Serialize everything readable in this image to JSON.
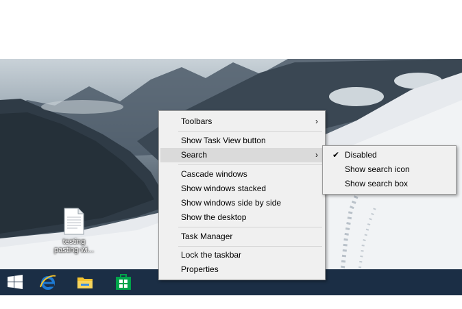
{
  "desktop": {
    "icon_label_line1": "testing",
    "icon_label_line2": "pasting wi..."
  },
  "context_menu": {
    "items": [
      {
        "label": "Toolbars",
        "has_submenu": true
      },
      {
        "label": "Show Task View button"
      },
      {
        "label": "Search",
        "has_submenu": true,
        "highlighted": true
      },
      {
        "label": "Cascade windows"
      },
      {
        "label": "Show windows stacked"
      },
      {
        "label": "Show windows side by side"
      },
      {
        "label": "Show the desktop"
      },
      {
        "label": "Task Manager"
      },
      {
        "label": "Lock the taskbar"
      },
      {
        "label": "Properties"
      }
    ],
    "arrow_glyph": "›"
  },
  "search_submenu": {
    "items": [
      {
        "label": "Disabled",
        "checked": true
      },
      {
        "label": "Show search icon"
      },
      {
        "label": "Show search box"
      }
    ],
    "check_glyph": "✔"
  },
  "taskbar": {
    "buttons": [
      "start-icon",
      "internet-explorer-icon",
      "file-explorer-icon",
      "store-icon"
    ]
  },
  "colors": {
    "taskbar": "#1b2e45",
    "menu_bg": "#f0f0f0",
    "menu_highlight": "#dadada",
    "ie_blue": "#1e7ad3",
    "explorer_yellow": "#f5c330",
    "store_green": "#00a44b"
  }
}
